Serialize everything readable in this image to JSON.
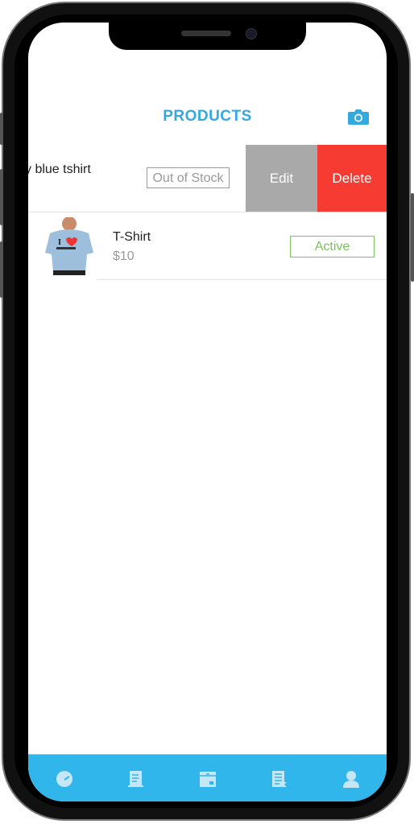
{
  "header": {
    "title": "PRODUCTS",
    "camera_icon": "camera-icon"
  },
  "colors": {
    "accent": "#33a9e0",
    "tabbar": "#30b6ea",
    "edit": "#a9a9a9",
    "delete": "#f63c32",
    "active": "#7cc25c"
  },
  "products": [
    {
      "name": "y blue tshirt",
      "status": "Out of Stock",
      "actions": {
        "edit": "Edit",
        "delete": "Delete"
      }
    },
    {
      "name": "T-Shirt",
      "price": "$10",
      "status": "Active"
    }
  ],
  "tabbar": {
    "icons": [
      "dashboard-icon",
      "orders-icon",
      "products-icon",
      "reports-icon",
      "profile-icon"
    ]
  }
}
